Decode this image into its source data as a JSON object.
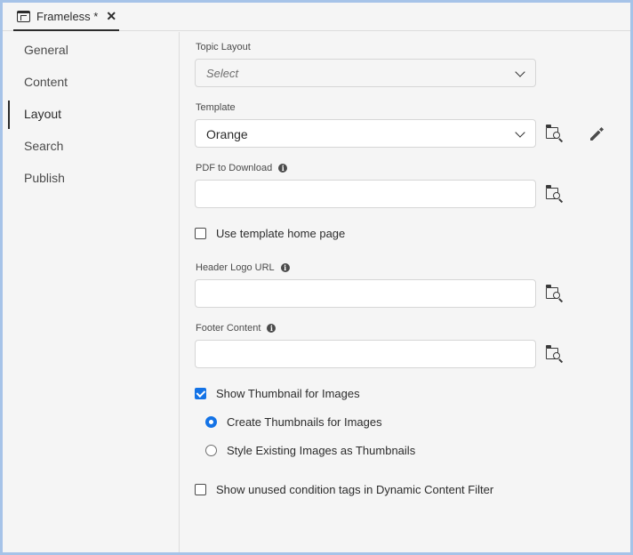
{
  "tab": {
    "title": "Frameless *",
    "close": "✕"
  },
  "sidebar": {
    "items": [
      {
        "label": "General"
      },
      {
        "label": "Content"
      },
      {
        "label": "Layout"
      },
      {
        "label": "Search"
      },
      {
        "label": "Publish"
      }
    ],
    "active": "Layout"
  },
  "form": {
    "topic_layout": {
      "label": "Topic Layout",
      "placeholder": "Select"
    },
    "template": {
      "label": "Template",
      "value": "Orange"
    },
    "pdf": {
      "label": "PDF to Download",
      "value": ""
    },
    "use_template_home": {
      "label": "Use template home page",
      "checked": false
    },
    "header_logo": {
      "label": "Header Logo URL",
      "value": ""
    },
    "footer": {
      "label": "Footer Content",
      "value": ""
    },
    "show_thumbnail": {
      "label": "Show Thumbnail for Images",
      "checked": true
    },
    "thumb_options": [
      {
        "label": "Create Thumbnails for Images",
        "selected": true
      },
      {
        "label": "Style Existing Images as Thumbnails",
        "selected": false
      }
    ],
    "unused_tags": {
      "label": "Show unused condition tags in Dynamic Content Filter",
      "checked": false
    }
  },
  "icons": {
    "info": "i",
    "browse": "folder-search-icon",
    "edit": "pencil-icon"
  },
  "colors": {
    "accent": "#1473e6",
    "frame": "#a6c3e8"
  }
}
